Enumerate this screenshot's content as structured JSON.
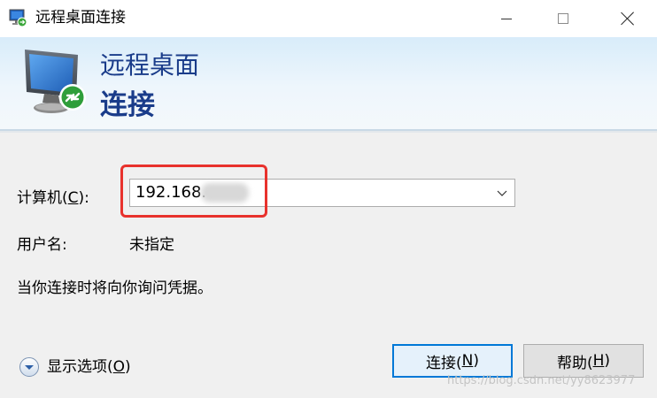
{
  "window": {
    "title": "远程桌面连接",
    "icon": "remote-desktop-icon"
  },
  "banner": {
    "line1": "远程桌面",
    "line2": "连接"
  },
  "form": {
    "computer_label_pre": "计算机(",
    "computer_label_key": "C",
    "computer_label_post": "):",
    "computer_value": "192.168.",
    "user_label": "用户名:",
    "user_value": "未指定",
    "credentials_note": "当你连接时将向你询问凭据。"
  },
  "footer": {
    "show_options_pre": "显示选项(",
    "show_options_key": "O",
    "show_options_post": ")",
    "connect_pre": "连接(",
    "connect_key": "N",
    "connect_post": ")",
    "help_pre": "帮助(",
    "help_key": "H",
    "help_post": ")"
  },
  "watermark": "https://blog.csdn.net/yy8623977",
  "colors": {
    "banner_title": "#1a3c8a",
    "highlight_box": "#e8322d",
    "default_button_border": "#0078d7"
  }
}
